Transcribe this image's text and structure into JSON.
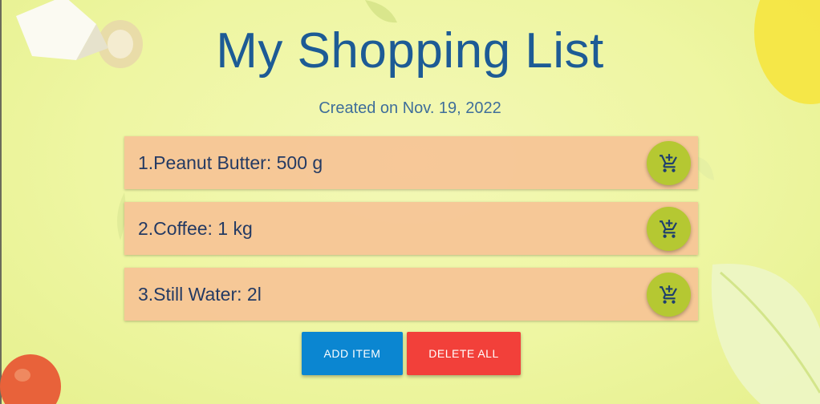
{
  "header": {
    "title": "My Shopping List",
    "created": "Created on Nov. 19, 2022"
  },
  "items": [
    {
      "label": "1.Peanut Butter: 500 g",
      "icon": "add-shopping-cart-icon"
    },
    {
      "label": "2.Coffee: 1 kg",
      "icon": "add-shopping-cart-icon"
    },
    {
      "label": "3.Still Water: 2l",
      "icon": "add-shopping-cart-icon"
    }
  ],
  "actions": {
    "add_label": "ADD ITEM",
    "delete_label": "DELETE ALL"
  },
  "colors": {
    "title": "#1d5b95",
    "item_bg": "#f6c496",
    "cart_button": "#b5c832",
    "add_button": "#0b86d1",
    "delete_button": "#f2403a"
  }
}
